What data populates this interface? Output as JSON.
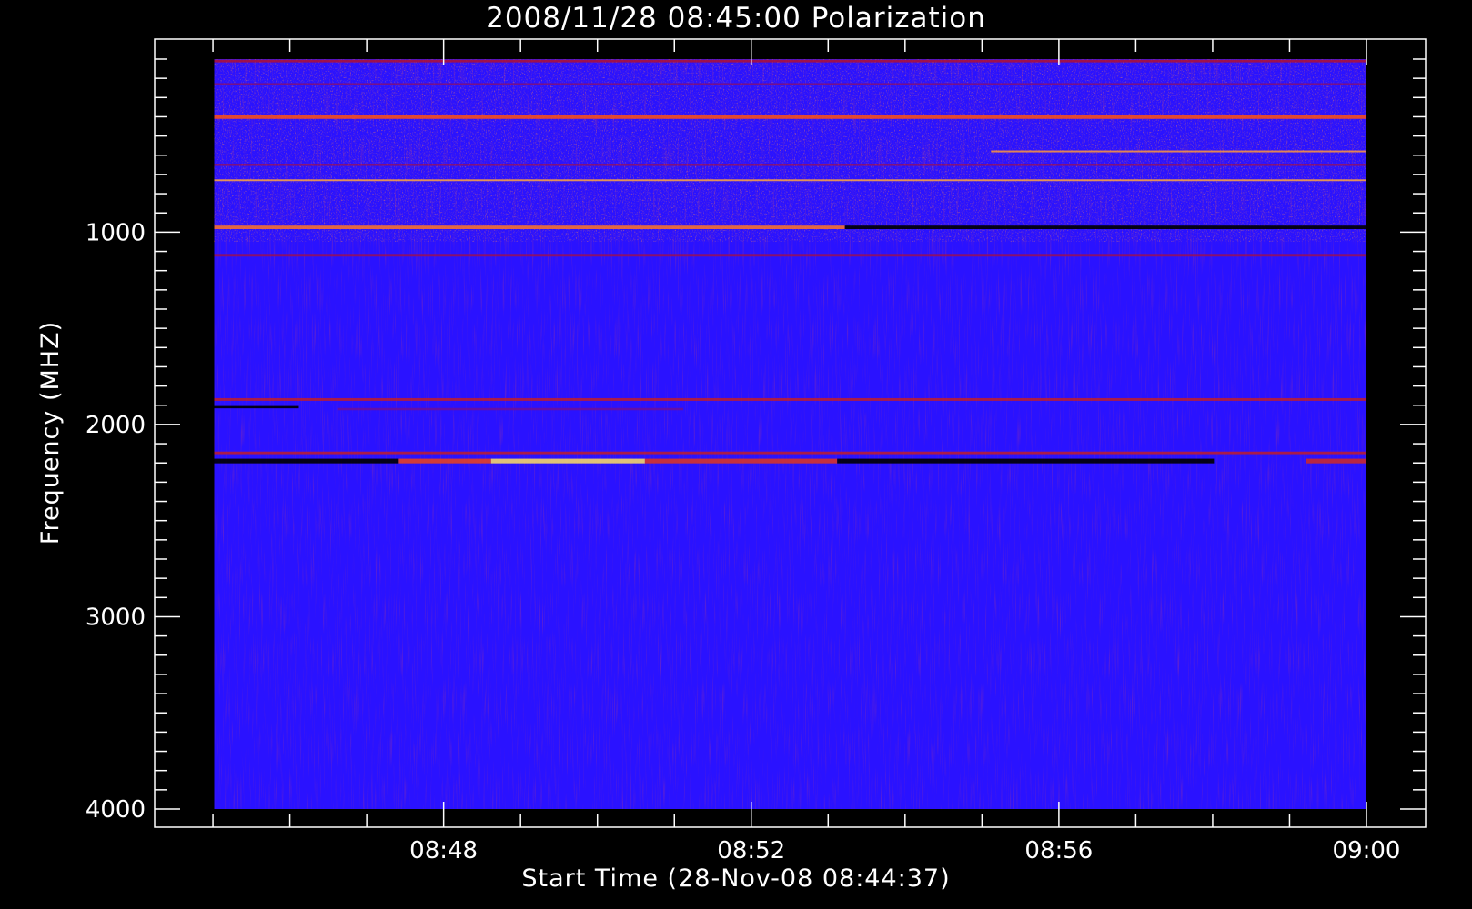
{
  "chart_data": {
    "type": "heatmap",
    "title": "2008/11/28 08:45:00 Polarization",
    "xlabel": "Start Time (28-Nov-08 08:44:37)",
    "ylabel": "Frequency (MHZ)",
    "x_tick_labels": [
      "08:48",
      "08:52",
      "08:56",
      "09:00"
    ],
    "x_tick_minutes": [
      3.383,
      7.383,
      11.383,
      15.383
    ],
    "y_ticks": [
      1000,
      2000,
      3000,
      4000
    ],
    "ylim": [
      4000,
      100
    ],
    "y_inverted": true,
    "data_time_range_minutes": [
      0.4,
      15.383
    ],
    "data_freq_range_mhz": [
      100,
      4000
    ],
    "background_color": "#2a12ff",
    "colormap": [
      "#000000",
      "#2a12ff",
      "#b01030",
      "#ff5010",
      "#ffe060"
    ],
    "bands": [
      {
        "freq": 110,
        "width": 14,
        "level": 0.55,
        "t_start": 0.4,
        "t_end": 15.383
      },
      {
        "freq": 230,
        "width": 10,
        "level": 0.45,
        "t_start": 0.4,
        "t_end": 15.383
      },
      {
        "freq": 400,
        "width": 22,
        "level": 0.8,
        "t_start": 0.4,
        "t_end": 15.383
      },
      {
        "freq": 580,
        "width": 8,
        "level": 0.9,
        "t_start": 10.5,
        "t_end": 15.383
      },
      {
        "freq": 650,
        "width": 10,
        "level": 0.55,
        "t_start": 0.4,
        "t_end": 15.383
      },
      {
        "freq": 730,
        "width": 7,
        "level": 0.92,
        "t_start": 0.4,
        "t_end": 15.383
      },
      {
        "freq": 975,
        "width": 18,
        "level": 0.85,
        "t_start": 0.4,
        "t_end": 8.6
      },
      {
        "freq": 975,
        "width": 18,
        "level": 0.0,
        "t_start": 8.6,
        "t_end": 15.383
      },
      {
        "freq": 1120,
        "width": 14,
        "level": 0.5,
        "t_start": 0.4,
        "t_end": 15.383
      },
      {
        "freq": 1870,
        "width": 14,
        "level": 0.6,
        "t_start": 0.4,
        "t_end": 15.383
      },
      {
        "freq": 1910,
        "width": 12,
        "level": 0.0,
        "t_start": 0.4,
        "t_end": 1.5
      },
      {
        "freq": 1920,
        "width": 12,
        "level": 0.4,
        "t_start": 2.0,
        "t_end": 6.5
      },
      {
        "freq": 2150,
        "width": 18,
        "level": 0.6,
        "t_start": 0.4,
        "t_end": 15.383
      },
      {
        "freq": 2190,
        "width": 24,
        "level": 0.0,
        "t_start": 0.4,
        "t_end": 2.8
      },
      {
        "freq": 2190,
        "width": 24,
        "level": 0.75,
        "t_start": 2.8,
        "t_end": 4.0
      },
      {
        "freq": 2190,
        "width": 24,
        "level": 1.0,
        "t_start": 4.0,
        "t_end": 6.0
      },
      {
        "freq": 2190,
        "width": 24,
        "level": 0.7,
        "t_start": 6.0,
        "t_end": 8.5
      },
      {
        "freq": 2190,
        "width": 24,
        "level": 0.0,
        "t_start": 8.5,
        "t_end": 13.4
      },
      {
        "freq": 2190,
        "width": 24,
        "level": 0.65,
        "t_start": 14.6,
        "t_end": 15.383
      }
    ]
  }
}
